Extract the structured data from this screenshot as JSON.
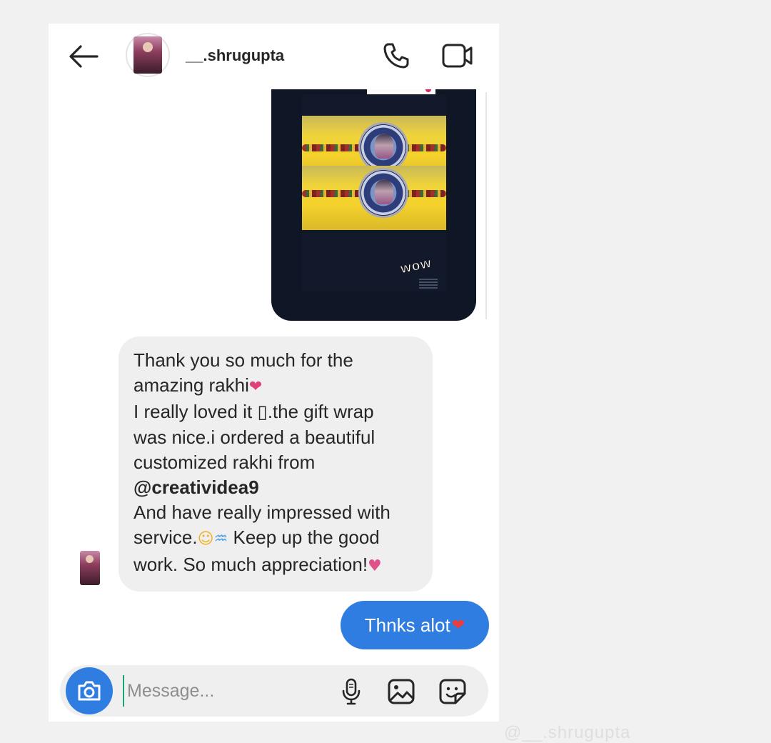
{
  "header": {
    "back_icon": "arrow-left-icon",
    "username": "__.shrugupta",
    "call_icon": "phone-icon",
    "video_icon": "video-camera-icon"
  },
  "shared_media": {
    "sticker_text": "wow"
  },
  "received_message": {
    "lines": [
      "Thank you so much for the",
      "amazing rakhi",
      "I really loved it ▯.the gift wrap",
      "was nice.i ordered a beautiful",
      "customized rakhi from",
      "@creatividea9",
      "And have really impressed with",
      "service.",
      " Keep up the good",
      "work. So much appreciation!"
    ],
    "emojis": {
      "heart": "❤",
      "angel": "☺",
      "rainbow": "♒",
      "two_hearts": "♥"
    }
  },
  "sent_message": {
    "text": "Thnks alot",
    "emoji": "❤"
  },
  "composer": {
    "placeholder": "Message...",
    "value": "",
    "camera_icon": "camera-icon",
    "mic_icon": "microphone-icon",
    "gallery_icon": "gallery-icon",
    "sticker_icon": "sticker-icon"
  },
  "watermark": "@__.shrugupta",
  "colors": {
    "accent_blue": "#2f7de1",
    "bubble_gray": "#efefef",
    "text_dark": "#262626",
    "placeholder_gray": "#8e8e8e",
    "background": "#f1f1f2"
  }
}
